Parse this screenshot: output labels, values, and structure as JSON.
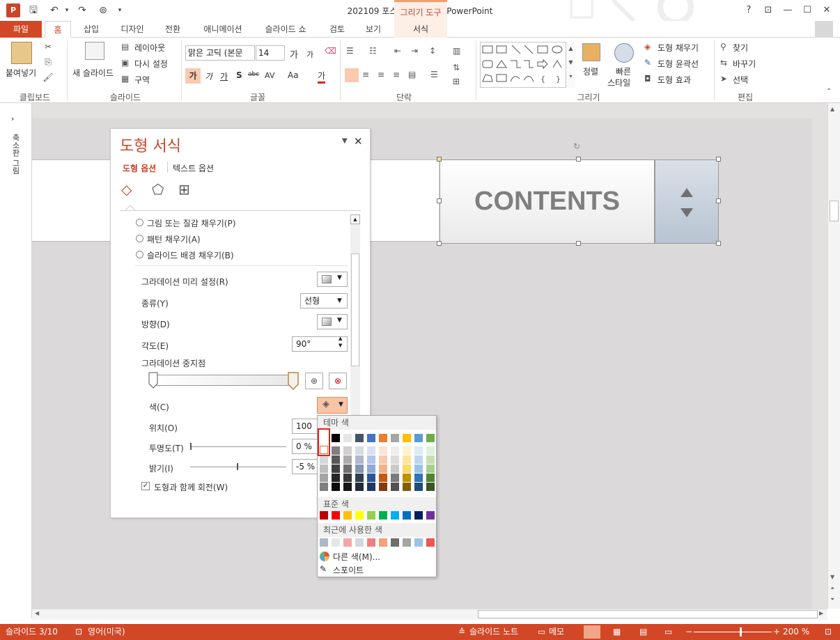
{
  "window": {
    "title": "202109 포스팅용 완성본 - PowerPoint",
    "contextual_group": "그리기 도구"
  },
  "qat": {
    "logo": "P",
    "save": "save-icon",
    "undo": "undo-icon",
    "redo": "redo-icon"
  },
  "window_buttons": {
    "help": "?",
    "restore_ribbon": "ribbon-display-icon",
    "minimize": "—",
    "maximize": "☐",
    "close": "✕"
  },
  "tabs": [
    {
      "label": "파일"
    },
    {
      "label": "홈"
    },
    {
      "label": "삽입"
    },
    {
      "label": "디자인"
    },
    {
      "label": "전환"
    },
    {
      "label": "애니메이션"
    },
    {
      "label": "슬라이드 쇼"
    },
    {
      "label": "검토"
    },
    {
      "label": "보기"
    },
    {
      "label": "서식"
    }
  ],
  "ribbon": {
    "clipboard": {
      "paste": "붙여넣기",
      "label": "클립보드"
    },
    "slides": {
      "new_slide": "새 슬라이드",
      "layout": "레이아웃",
      "reset": "다시 설정",
      "section": "구역",
      "label": "슬라이드"
    },
    "font": {
      "font_name": "맑은 고딕 (본문",
      "font_size": "14",
      "grow": "가",
      "shrink": "가",
      "bold": "가",
      "italic": "가",
      "underline": "가",
      "shadow": "S",
      "strike": "abc",
      "spacing": "AV",
      "case": "Aa",
      "color": "가",
      "label": "글꼴"
    },
    "paragraph": {
      "label": "단락"
    },
    "drawing": {
      "arrange": "정렬",
      "quick_styles_1": "빠른",
      "quick_styles_2": "스타일",
      "fill": "도형 채우기",
      "outline": "도형 윤곽선",
      "effects": "도형 효과",
      "label": "그리기"
    },
    "editing": {
      "find": "찾기",
      "replace": "바꾸기",
      "select": "선택",
      "label": "편집"
    }
  },
  "thumbnail_pane": {
    "label": "축소판 그림"
  },
  "slide": {
    "contents_text": "CONTENTS"
  },
  "format_pane": {
    "title": "도형 서식",
    "tab_shape": "도형 옵션",
    "tab_text": "텍스트 옵션",
    "fill_options": [
      "그림 또는 질감 채우기(P)",
      "패턴 채우기(A)",
      "슬라이드 배경 채우기(B)"
    ],
    "gradient_preset": "그라데이션 미리 설정(R)",
    "type_label": "종류(Y)",
    "type_value": "선형",
    "direction_label": "방향(D)",
    "angle_label": "각도(E)",
    "angle_value": "90°",
    "stops_label": "그라데이션 중지점",
    "color_label": "색(C)",
    "position_label": "위치(O)",
    "position_value": "100 %",
    "transparency_label": "투명도(T)",
    "transparency_value": "0 %",
    "brightness_label": "밝기(I)",
    "brightness_value": "-5 %",
    "rotate_label": "도형과 함께 회전(W)"
  },
  "color_menu": {
    "theme_header": "테마 색",
    "standard_header": "표준 색",
    "recent_header": "최근에 사용한 색",
    "more_colors": "다른 색(M)...",
    "eyedropper": "스포이트",
    "theme_top": [
      "#ffffff",
      "#000000",
      "#e7e6e6",
      "#44546a",
      "#4472c4",
      "#ed7d31",
      "#a5a5a5",
      "#ffc000",
      "#5b9bd5",
      "#70ad47"
    ],
    "theme_shades": [
      [
        "#f2f2f2",
        "#7f7f7f",
        "#d0cece",
        "#d6dce4",
        "#d9e2f3",
        "#fbe5d5",
        "#ededed",
        "#fff2cc",
        "#deebf6",
        "#e2efd9"
      ],
      [
        "#d8d8d8",
        "#595959",
        "#aeabab",
        "#adb9ca",
        "#b4c6e7",
        "#f7cbac",
        "#dbdbdb",
        "#fee599",
        "#bdd7ee",
        "#c5e0b3"
      ],
      [
        "#bfbfbf",
        "#3f3f3f",
        "#757070",
        "#8496b0",
        "#8eaadb",
        "#f4b183",
        "#c9c9c9",
        "#ffd965",
        "#9cc3e5",
        "#a8d08d"
      ],
      [
        "#a5a5a5",
        "#262626",
        "#3a3838",
        "#323f4f",
        "#2f5496",
        "#c55a11",
        "#7b7b7b",
        "#bf9000",
        "#2e75b5",
        "#538135"
      ],
      [
        "#7f7f7f",
        "#0c0c0c",
        "#171616",
        "#222a35",
        "#1f3864",
        "#833c0b",
        "#525252",
        "#7f6000",
        "#1e4e79",
        "#375623"
      ]
    ],
    "standard": [
      "#c00000",
      "#ff0000",
      "#ffc000",
      "#ffff00",
      "#92d050",
      "#00b050",
      "#00b0f0",
      "#0070c0",
      "#002060",
      "#7030a0"
    ],
    "recent": [
      "#adb9ca",
      "#e7e6e6",
      "#f4a6a6",
      "#d0d8e0",
      "#f08080",
      "#f4a07a",
      "#6e6e6e",
      "#a5a5a5",
      "#9cc3e5",
      "#ee5555"
    ]
  },
  "status": {
    "slide": "슬라이드 3/10",
    "language": "영어(미국)",
    "notes": "슬라이드 노트",
    "comments": "메모",
    "zoom": "200 %"
  }
}
